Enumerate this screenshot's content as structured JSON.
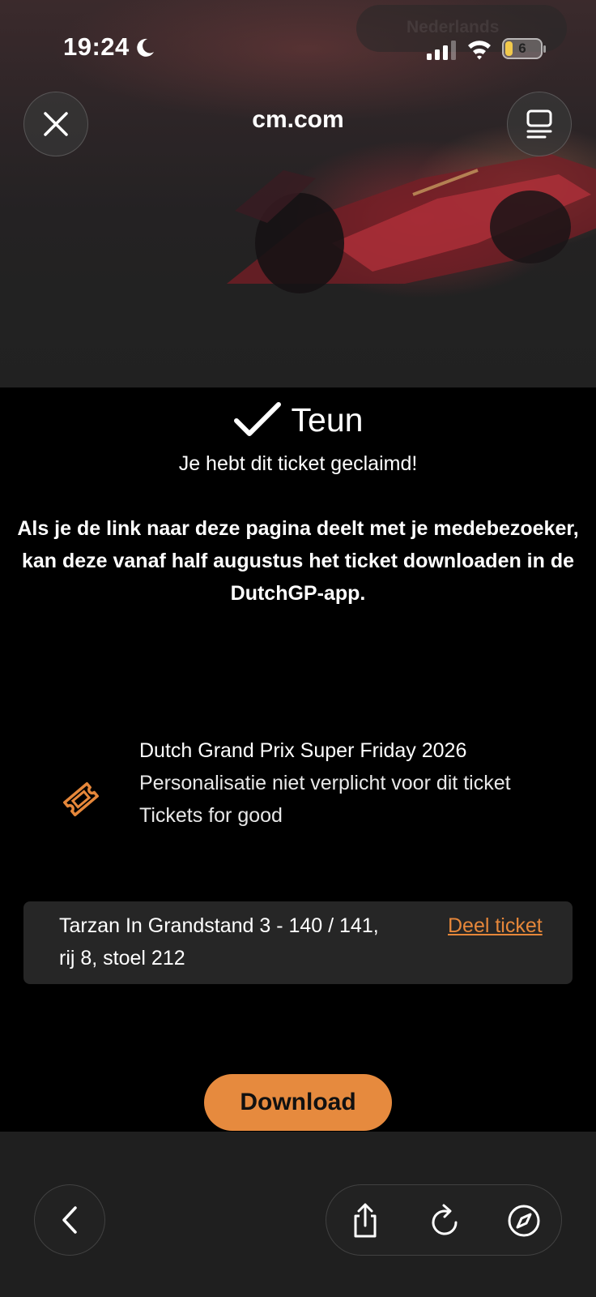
{
  "status_bar": {
    "time": "19:24",
    "battery": "6"
  },
  "header": {
    "language": "Nederlands",
    "domain": "cm.com"
  },
  "claim": {
    "name": "Teun",
    "subtitle": "Je hebt dit ticket geclaimd!",
    "info": "Als je de link naar deze pagina deelt met je medebezoeker, kan deze vanaf half augustus het ticket downloaden in de DutchGP-app."
  },
  "ticket": {
    "event": "Dutch Grand Prix Super Friday 2026",
    "personalisation": "Personalisatie niet verplicht voor dit ticket",
    "category": "Tickets for good",
    "seat": "Tarzan In Grandstand 3 - 140 / 141, rij 8, stoel 212",
    "share_label": "Deel ticket"
  },
  "actions": {
    "download_label": "Download"
  },
  "colors": {
    "accent": "#e68a3e",
    "background": "#000000",
    "seat_box": "#262626",
    "toolbar": "#1f1f1f"
  },
  "icons": {
    "close": "close-icon",
    "reader": "reader-mode-icon",
    "ticket": "ticket-icon",
    "back": "chevron-left-icon",
    "share": "share-icon",
    "reload": "reload-icon",
    "compass": "compass-icon"
  }
}
